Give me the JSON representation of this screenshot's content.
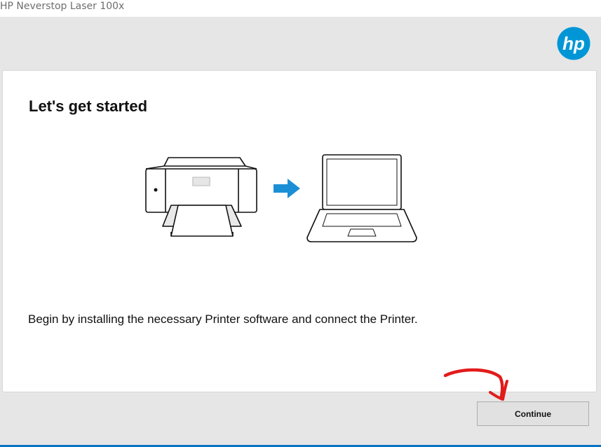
{
  "window": {
    "title": "HP Neverstop Laser 100x"
  },
  "brand": {
    "logo_icon": "hp-logo-icon",
    "logo_text": "hp",
    "color": "#0096d6"
  },
  "main": {
    "heading": "Let's get started",
    "description": "Begin by installing the necessary Printer software and connect the Printer.",
    "illustration": {
      "icons": [
        "printer-icon",
        "arrow-right-icon",
        "laptop-icon"
      ],
      "arrow_color": "#1b8fd6"
    }
  },
  "footer": {
    "continue_label": "Continue"
  },
  "annotation": {
    "icon": "red-hand-drawn-arrow-icon",
    "color": "#e21b1b"
  }
}
